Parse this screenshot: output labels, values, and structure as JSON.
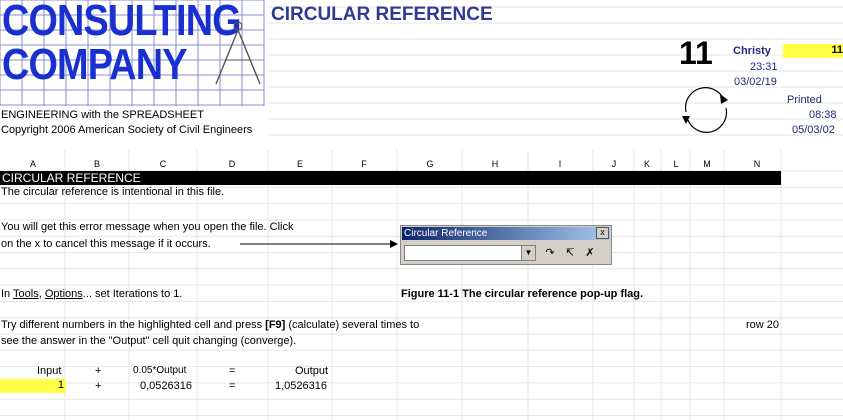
{
  "logo": {
    "line1": "CONSULTING",
    "line2": "COMPANY"
  },
  "title": "CIRCULAR REFERENCE",
  "header": {
    "sheet_number": "11",
    "user_name": "Christy",
    "time": "23:31",
    "date": "03/02/19",
    "yellow_value": "11",
    "printed_label": "Printed",
    "printed_time": "08:38",
    "printed_date": "05/03/02"
  },
  "subtitle": "ENGINEERING with the SPREADSHEET",
  "copyright": "Copyright 2006 American Society of Civil Engineers",
  "columns": [
    "A",
    "B",
    "C",
    "D",
    "E",
    "F",
    "G",
    "H",
    "I",
    "J",
    "K",
    "L",
    "M",
    "N"
  ],
  "section_title": "CIRCULAR REFERENCE",
  "text": {
    "intentional": "The circular reference  is  intentional in this file.",
    "error_line1": "You will get this error message when you open the file. Click",
    "error_line2": "on the x to cancel this message if it occurs.",
    "tools_prefix": "In ",
    "tools_word": "Tools",
    "tools_comma": ",  ",
    "options_word": "Options",
    "tools_suffix": "...    set Iterations to 1.",
    "figure_caption": "Figure 11-1  The circular reference pop-up flag.",
    "try_line1_a": "Try different numbers in the highlighted cell and press ",
    "try_line1_b": "[F9]",
    "try_line1_c": " (calculate) several times to",
    "try_line2": "see the answer  in  the  \"Output\"  cell  quit  changing (converge).",
    "row20": "row 20"
  },
  "popup": {
    "title": "Circular Reference",
    "close": "x"
  },
  "calc": {
    "header": {
      "input": "Input",
      "plus": "+",
      "formula": "0.05*Output",
      "equals": "=",
      "output": "Output"
    },
    "row": {
      "input": "1",
      "plus": "+",
      "formula_value": "0,0526316",
      "equals": "=",
      "output": "1,0526316"
    }
  },
  "colors": {
    "logo": "#1a2fd0",
    "title": "#2e3a96",
    "highlight": "#ffff44",
    "popup_title": "#0a246a"
  }
}
